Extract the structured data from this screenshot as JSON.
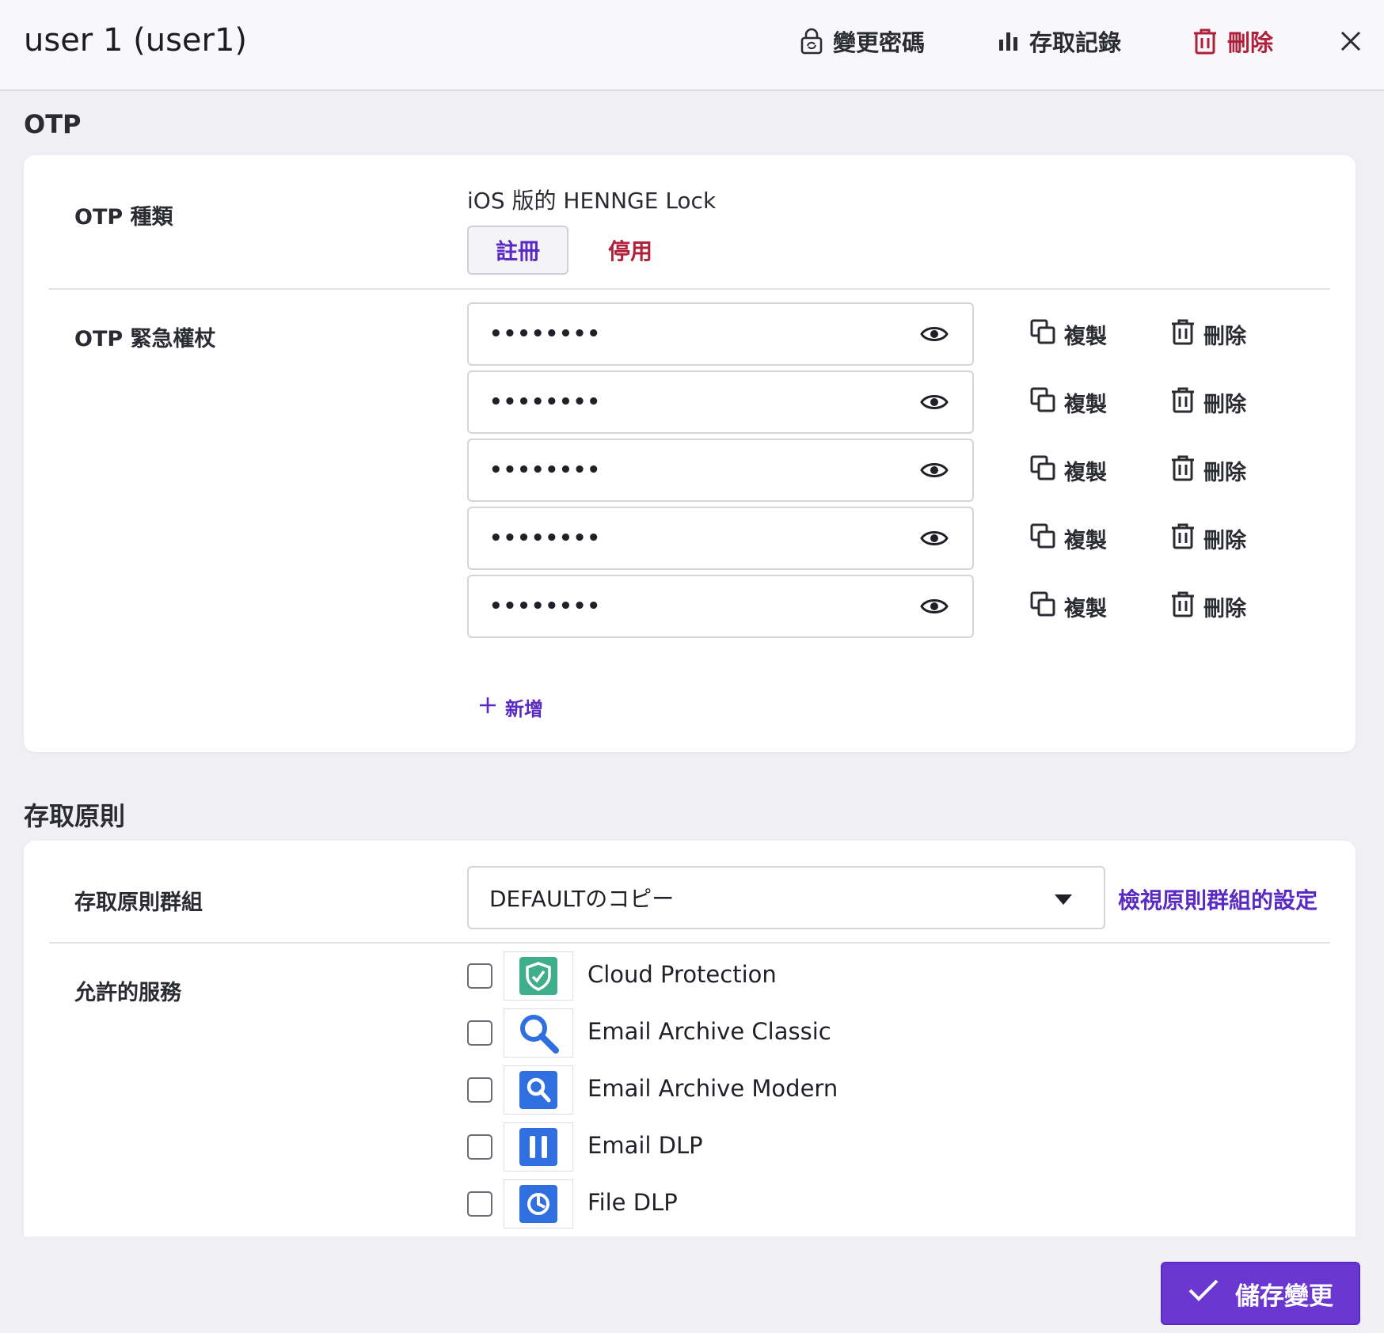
{
  "header": {
    "title": "user 1 (user1)",
    "change_password": "變更密碼",
    "access_log": "存取記錄",
    "delete": "刪除"
  },
  "otp": {
    "section_title": "OTP",
    "type_label": "OTP 種類",
    "type_value": "iOS 版的 HENNGE Lock",
    "register": "註冊",
    "disable": "停用",
    "emergency_label": "OTP 緊急權杖",
    "tokens": [
      {
        "value": "••••••••",
        "copy": "複製",
        "delete": "刪除"
      },
      {
        "value": "••••••••",
        "copy": "複製",
        "delete": "刪除"
      },
      {
        "value": "••••••••",
        "copy": "複製",
        "delete": "刪除"
      },
      {
        "value": "••••••••",
        "copy": "複製",
        "delete": "刪除"
      },
      {
        "value": "••••••••",
        "copy": "複製",
        "delete": "刪除"
      }
    ],
    "add": "新增"
  },
  "policy": {
    "section_title": "存取原則",
    "group_label": "存取原則群組",
    "group_value": "DEFAULTのコピー",
    "view_link": "檢視原則群組的設定",
    "services_label": "允許的服務",
    "services": [
      {
        "name": "Cloud Protection",
        "icon": "cloud-protection-icon",
        "color": "#3fae8a"
      },
      {
        "name": "Email Archive Classic",
        "icon": "email-archive-classic-icon",
        "color": "#2f6fe0"
      },
      {
        "name": "Email Archive Modern",
        "icon": "email-archive-modern-icon",
        "color": "#2f6fe0"
      },
      {
        "name": "Email DLP",
        "icon": "email-dlp-icon",
        "color": "#2f6fe0"
      },
      {
        "name": "File DLP",
        "icon": "file-dlp-icon",
        "color": "#2f6fe0"
      }
    ]
  },
  "footer": {
    "save": "儲存變更"
  },
  "colors": {
    "accent": "#6a38d0",
    "danger": "#b0203b",
    "link": "#5a2bc2"
  }
}
